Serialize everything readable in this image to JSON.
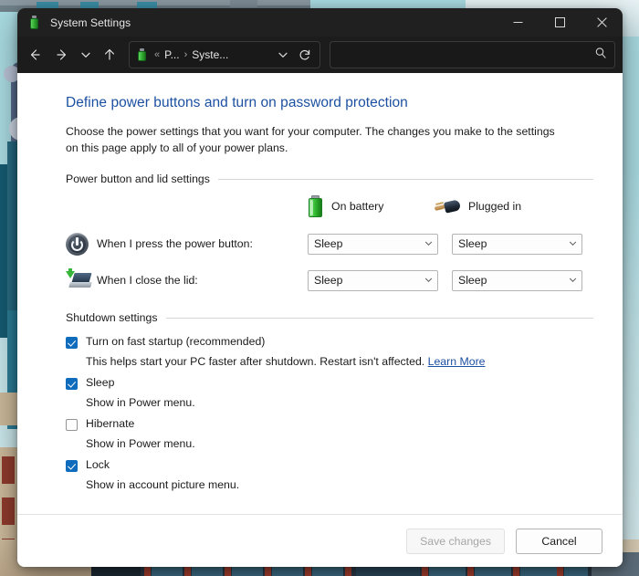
{
  "window": {
    "title": "System Settings",
    "title_icon": "battery-icon",
    "controls": {
      "minimize": "minimize-icon",
      "maximize": "maximize-icon",
      "close": "close-icon"
    }
  },
  "navbar": {
    "back": "back-arrow-icon",
    "forward": "forward-arrow-icon",
    "recent": "chevron-down-icon",
    "up": "up-arrow-icon",
    "address": {
      "icon": "battery-icon",
      "overflow": "«",
      "crumb1": "P...",
      "separator": "›",
      "crumb2": "Syste...",
      "dropdown": "chevron-down-icon",
      "refresh": "refresh-icon"
    },
    "search": {
      "value": "",
      "placeholder": "",
      "icon": "search-icon"
    }
  },
  "page": {
    "heading": "Define power buttons and turn on password protection",
    "description": "Choose the power settings that you want for your computer. The changes you make to the settings on this page apply to all of your power plans."
  },
  "power_section": {
    "group_label": "Power button and lid settings",
    "columns": [
      {
        "label": "On battery",
        "icon": "battery-icon"
      },
      {
        "label": "Plugged in",
        "icon": "power-plug-icon"
      }
    ],
    "rows": [
      {
        "icon": "power-button-icon",
        "label": "When I press the power button:",
        "on_battery": "Sleep",
        "plugged_in": "Sleep"
      },
      {
        "icon": "laptop-lid-icon",
        "label": "When I close the lid:",
        "on_battery": "Sleep",
        "plugged_in": "Sleep"
      }
    ]
  },
  "shutdown_section": {
    "group_label": "Shutdown settings",
    "options": [
      {
        "label": "Turn on fast startup (recommended)",
        "checked": true,
        "description": "This helps start your PC faster after shutdown. Restart isn't affected.",
        "link": "Learn More"
      },
      {
        "label": "Sleep",
        "checked": true,
        "description": "Show in Power menu.",
        "link": ""
      },
      {
        "label": "Hibernate",
        "checked": false,
        "description": "Show in Power menu.",
        "link": ""
      },
      {
        "label": "Lock",
        "checked": true,
        "description": "Show in account picture menu.",
        "link": ""
      }
    ]
  },
  "footer": {
    "save_label": "Save changes",
    "cancel_label": "Cancel",
    "save_enabled": false
  },
  "colors": {
    "accent_link": "#1c50a1",
    "checkbox_checked": "#0f6cbd",
    "titlebar": "#202020",
    "navbar": "#1c1c1c",
    "battery_green": "#2fa82f"
  }
}
